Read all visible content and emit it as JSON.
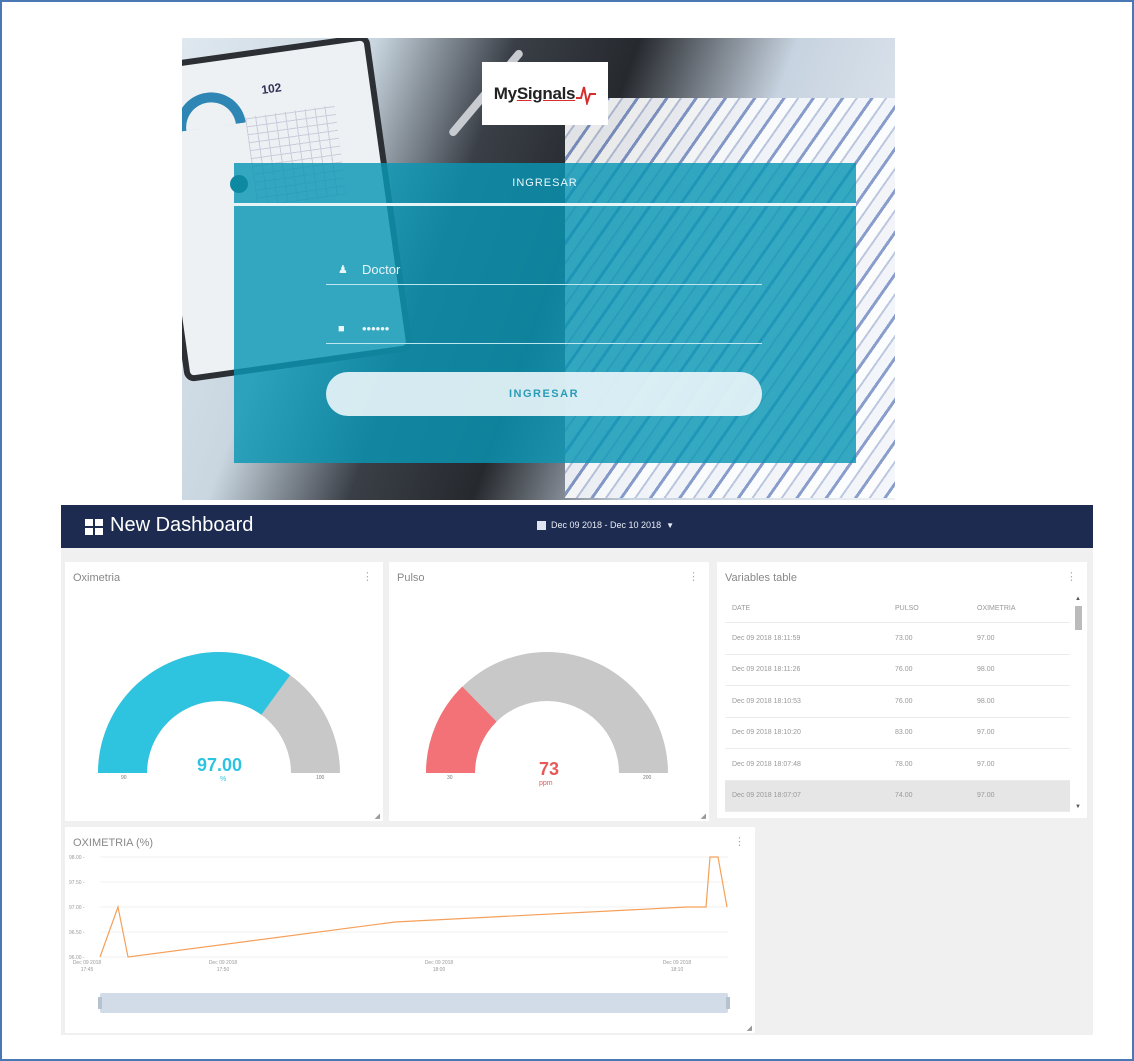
{
  "login": {
    "logo_text_prefix": "My",
    "logo_text_main": "Signals",
    "tab_label": "INGRESAR",
    "username_value": "Doctor",
    "password_value": "••••••",
    "submit_label": "INGRESAR",
    "background_tablet_number": "102"
  },
  "dashboard": {
    "title": "New Dashboard",
    "date_range": "Dec 09 2018 - Dec 10 2018",
    "oximetria_card": {
      "title": "Oximetria",
      "value": "97.00",
      "unit": "%",
      "min_label": "90",
      "max_label": "100",
      "min": 90,
      "max": 100,
      "current": 97,
      "fill_color": "#2ec4e0",
      "rest_color": "#c8c8c8",
      "value_color": "#2ec4e0"
    },
    "pulso_card": {
      "title": "Pulso",
      "value": "73",
      "unit": "ppm",
      "min_label": "30",
      "max_label": "200",
      "min": 30,
      "max": 200,
      "current": 73,
      "fill_color": "#f27278",
      "rest_color": "#c8c8c8",
      "value_color": "#e85a5a"
    },
    "variables_table": {
      "title": "Variables table",
      "columns": [
        "DATE",
        "PULSO",
        "OXIMETRIA"
      ],
      "rows": [
        [
          "Dec 09 2018 18:11:59",
          "73.00",
          "97.00"
        ],
        [
          "Dec 09 2018 18:11:26",
          "76.00",
          "98.00"
        ],
        [
          "Dec 09 2018 18:10:53",
          "76.00",
          "98.00"
        ],
        [
          "Dec 09 2018 18:10:20",
          "83.00",
          "97.00"
        ],
        [
          "Dec 09 2018 18:07:48",
          "78.00",
          "97.00"
        ],
        [
          "Dec 09 2018 18:07:07",
          "74.00",
          "97.00"
        ]
      ],
      "selected_row": 5
    },
    "oximetria_chart": {
      "title": "OXIMETRIA (%)",
      "y_ticks": [
        "98.00 -",
        "97.50 -",
        "97.00 -",
        "96.50 -",
        "96.00 -"
      ],
      "x_ticks": [
        [
          "Dec 09 2018",
          "17:45"
        ],
        [
          "Dec 09 2018",
          "17:50"
        ],
        [
          "Dec 09 2018",
          "18:00"
        ],
        [
          "Dec 09 2018",
          "18:10"
        ]
      ],
      "line_color": "#f5a05a"
    }
  },
  "chart_data": {
    "type": "line",
    "title": "OXIMETRIA (%)",
    "xlabel": "",
    "ylabel": "",
    "ylim": [
      96.0,
      98.0
    ],
    "x": [
      "17:45",
      "17:46",
      "17:47",
      "18:06",
      "18:07:07",
      "18:07:48",
      "18:10:20",
      "18:10:53",
      "18:11:26",
      "18:11:59"
    ],
    "series": [
      {
        "values": [
          96.0,
          97.0,
          96.0,
          96.7,
          97.0,
          97.0,
          97.0,
          98.0,
          98.0,
          97.0
        ]
      }
    ],
    "grid": true
  }
}
